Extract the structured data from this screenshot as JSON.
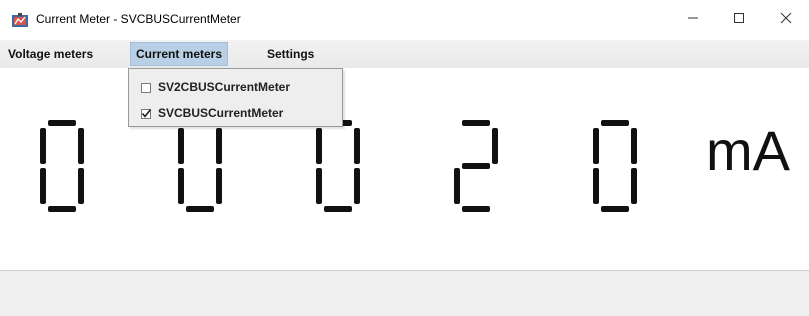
{
  "window": {
    "title": "Current Meter - SVCBUSCurrentMeter",
    "icon": "app-icon",
    "controls": {
      "minimize": "minimize-icon",
      "maximize": "maximize-icon",
      "close": "close-icon"
    }
  },
  "menubar": {
    "items": [
      {
        "label": "Voltage meters"
      },
      {
        "label": "Current meters",
        "active": true
      },
      {
        "label": "Settings"
      }
    ]
  },
  "dropdown": {
    "items": [
      {
        "label": "SV2CBUSCurrentMeter",
        "checked": false
      },
      {
        "label": "SVCBUSCurrentMeter",
        "checked": true
      }
    ]
  },
  "display": {
    "digits": [
      "0",
      "0",
      "0",
      "2",
      "0"
    ],
    "unit": "mA",
    "segment_color": "#111111"
  }
}
